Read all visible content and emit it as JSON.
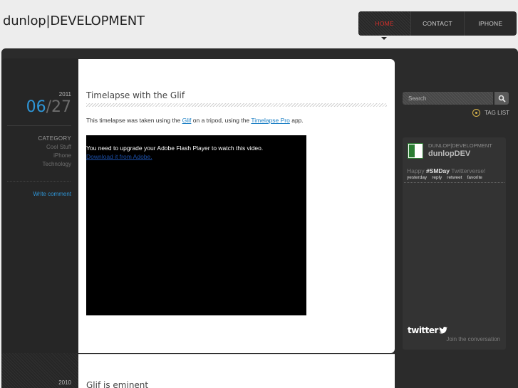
{
  "header": {
    "site_title": "dunlop|DEVELOPMENT",
    "nav": [
      {
        "label": "HOME",
        "active": true
      },
      {
        "label": "CONTACT",
        "active": false
      },
      {
        "label": "IPHONE",
        "active": false
      }
    ]
  },
  "post1": {
    "year": "2011",
    "month": "06",
    "day": "/27",
    "category_title": "CATEGORY",
    "categories": [
      "Cool Stuff",
      "iPhone",
      "Technology"
    ],
    "write_comment": "Write comment",
    "title": "Timelapse with the Glif",
    "body_prefix": "This timelapse was taken using the ",
    "link1": "Glif",
    "body_mid": " on a tripod, using the ",
    "link2": "Timelapse Pro",
    "body_suffix": " app.",
    "video_message": "You need to upgrade your Adobe Flash Player to watch this video.",
    "video_link": "Download it from Adobe."
  },
  "post2": {
    "year": "2010",
    "title": "Glif is eminent"
  },
  "sidebar": {
    "search_placeholder": "Search",
    "tag_list": "TAG LIST",
    "twitter": {
      "handle_small": "DUNLOP|DEVELOPMENT",
      "handle_big": "dunlopDEV",
      "tweet_pre": "Happy ",
      "tweet_hashtag": "#SMDay",
      "tweet_post": " Twitterverse!",
      "actions": [
        "yesterday",
        "reply",
        "retweet",
        "favorite"
      ],
      "logo": "twitter",
      "join": "Join the conversation"
    }
  },
  "colors": {
    "accent_blue": "#2e95d6",
    "nav_active_red": "#d5302b",
    "frame_dark": "#2b2b2b"
  }
}
